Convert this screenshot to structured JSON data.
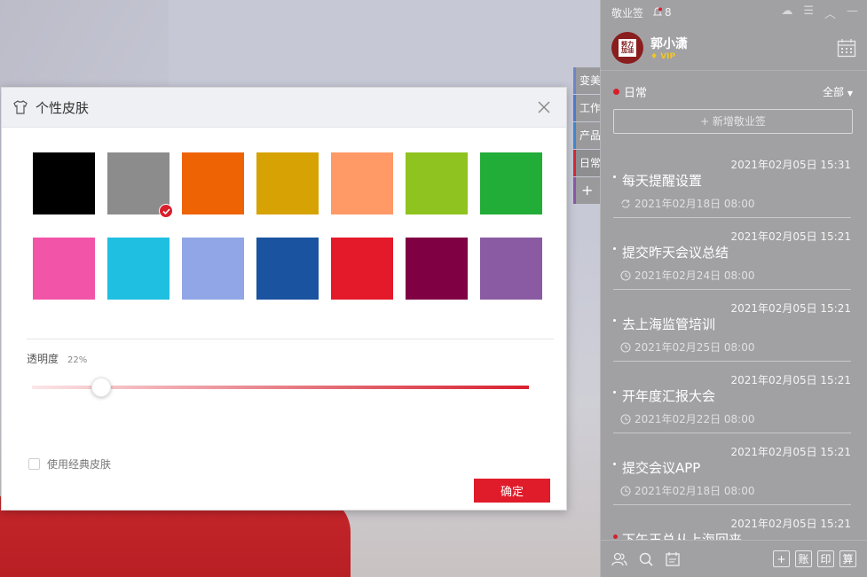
{
  "side_tabs": [
    "变美",
    "工作",
    "产品",
    "日常",
    "+"
  ],
  "panel": {
    "app_title": "敬业签",
    "bell_count": "8",
    "user_name": "郭小潇",
    "vip_label": "VIP",
    "avatar_text": "努力 加油",
    "category": "日常",
    "filter": "全部",
    "new_button": "+ 新增敬业签",
    "memos": [
      {
        "time": "2021年02月05日 15:31",
        "title": "每天提醒设置",
        "remind": "2021年02月18日 08:00",
        "repeat": true
      },
      {
        "time": "2021年02月05日 15:21",
        "title": "提交昨天会议总结",
        "remind": "2021年02月24日 08:00",
        "repeat": false
      },
      {
        "time": "2021年02月05日 15:21",
        "title": "去上海监管培训",
        "remind": "2021年02月25日 08:00",
        "repeat": false
      },
      {
        "time": "2021年02月05日 15:21",
        "title": "开年度汇报大会",
        "remind": "2021年02月22日 08:00",
        "repeat": false
      },
      {
        "time": "2021年02月05日 15:21",
        "title": "提交会议APP",
        "remind": "2021年02月18日 08:00",
        "repeat": false
      },
      {
        "time": "2021年02月05日 15:21",
        "title": "下午王总从上海回来",
        "remind": "",
        "repeat": false
      }
    ],
    "bottom_buttons": [
      "+",
      "账",
      "印",
      "算"
    ]
  },
  "dialog": {
    "title": "个性皮肤",
    "swatches": [
      "#000000",
      "#8c8c8c",
      "#ee6405",
      "#d6a204",
      "#ff9966",
      "#8fc31f",
      "#22ac38",
      "#f254a8",
      "#1fbfe1",
      "#90a6e6",
      "#1a53a0",
      "#e41a2a",
      "#800044",
      "#8a5ba3"
    ],
    "selected_index": 1,
    "opacity_label": "透明度",
    "opacity_value": "22%",
    "opacity_fraction": 0.14,
    "classic_label": "使用经典皮肤",
    "ok_label": "确定"
  },
  "colors": {
    "accent": "#e01c2b",
    "panel_bg": "#a1a1a4"
  }
}
